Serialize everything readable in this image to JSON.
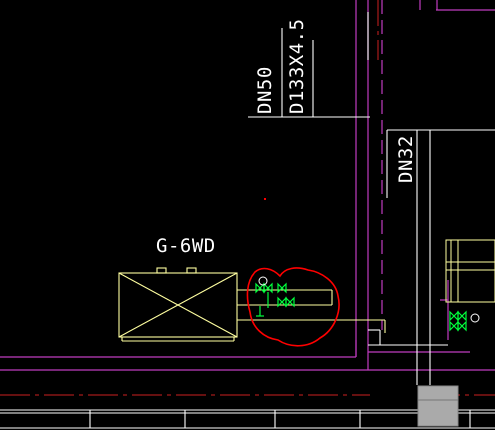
{
  "drawing": {
    "background": "#000000",
    "colors": {
      "wall": "#c03cc0",
      "pipe_white": "#ffffff",
      "pipe_yellow": "#ffffa0",
      "valve_green": "#00ff3c",
      "markup_red": "#ff0000",
      "centerline_red": "#cc2020",
      "block_gray": "#aaaaaa"
    },
    "labels": {
      "pipe_dn50": "DN50",
      "pipe_d133": "D133X4.5",
      "pipe_dn32": "DN32",
      "equipment_tag": "G-6WD"
    }
  }
}
